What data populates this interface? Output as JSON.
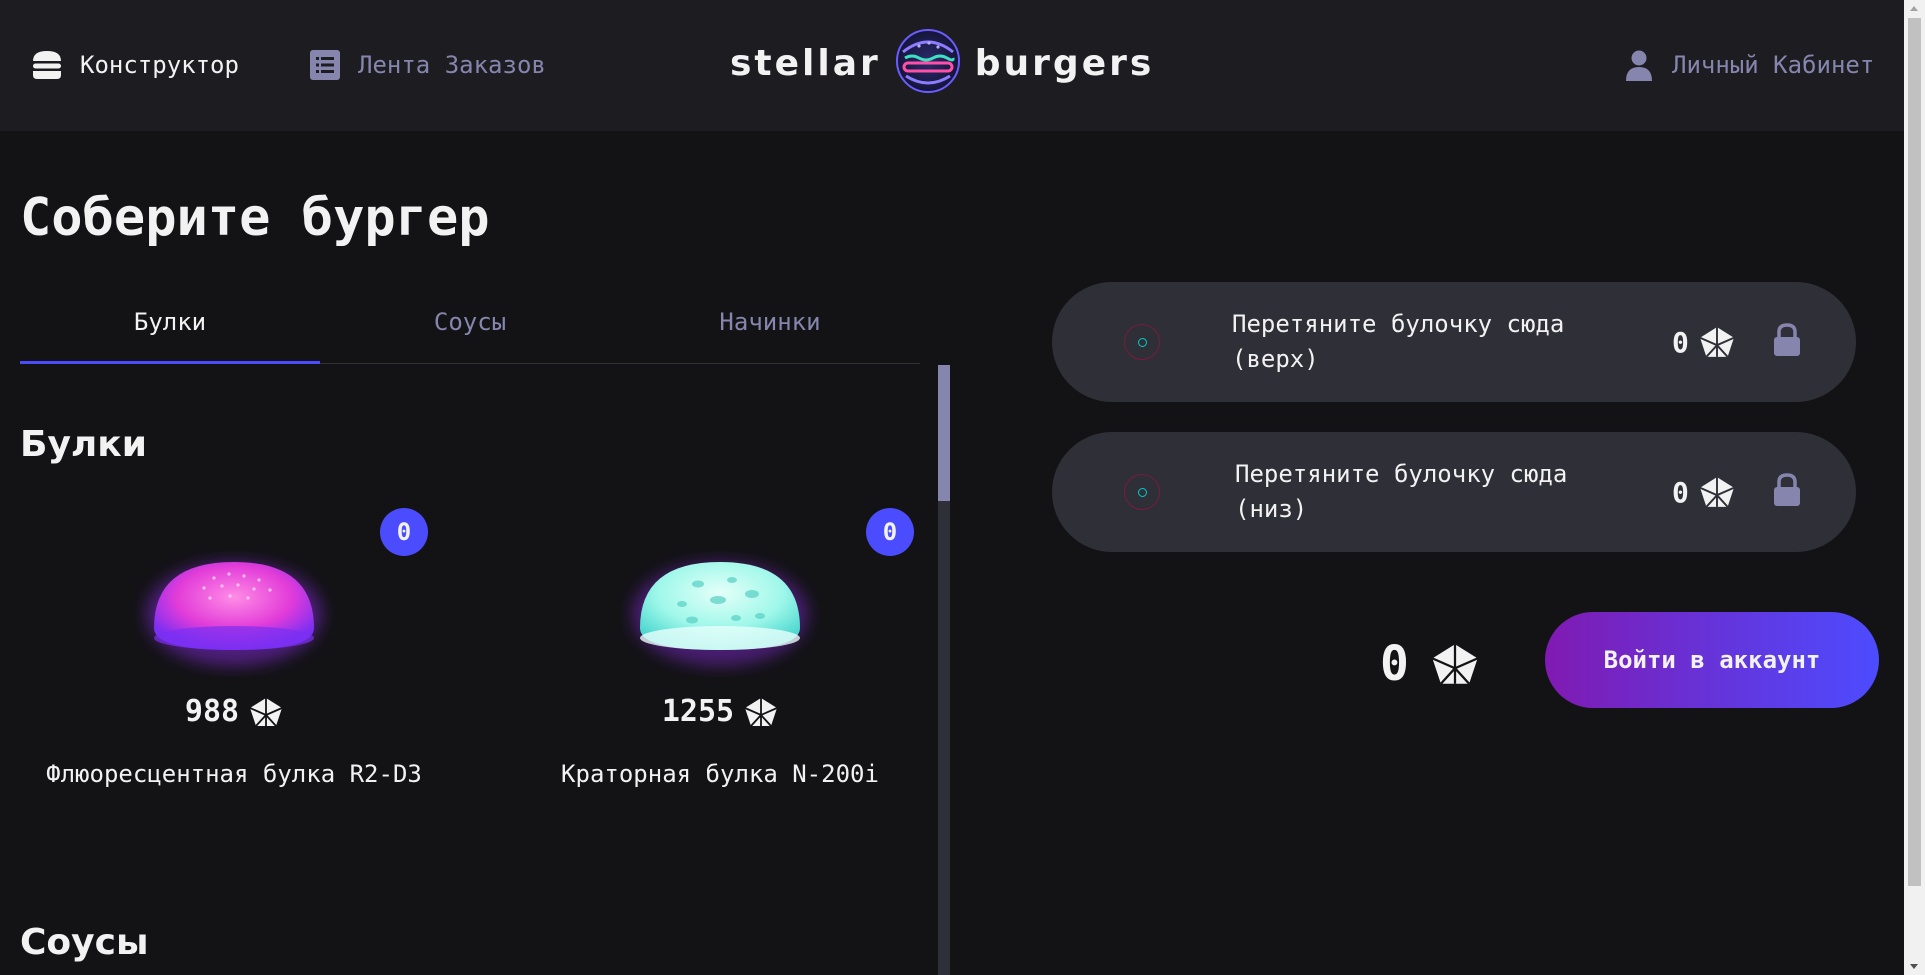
{
  "header": {
    "constructor_label": "Конструктор",
    "feed_label": "Лента Заказов",
    "logo_left": "stellar",
    "logo_right": "burgers",
    "account_label": "Личный Кабинет"
  },
  "main": {
    "title": "Соберите бургер",
    "tabs": [
      {
        "label": "Булки",
        "active": true
      },
      {
        "label": "Соусы",
        "active": false
      },
      {
        "label": "Начинки",
        "active": false
      }
    ],
    "sections": [
      {
        "title": "Булки"
      },
      {
        "title": "Соусы"
      }
    ],
    "ingredients": [
      {
        "name": "Флюоресцентная булка R2-D3",
        "price": "988",
        "count": "0",
        "color": "#e23cd8"
      },
      {
        "name": "Краторная булка N-200i",
        "price": "1255",
        "count": "0",
        "color": "#7ff5e6"
      }
    ]
  },
  "constructor": {
    "top_slot": {
      "text": "Перетяните булочку сюда (верх)",
      "price": "0"
    },
    "bottom_slot": {
      "text": "Перетяните булочку сюда (низ)",
      "price": "0"
    },
    "total": "0",
    "login_button": "Войти в аккаунт"
  },
  "colors": {
    "accent": "#4c4cff",
    "inactive": "#8585ad",
    "background": "#131316",
    "header": "#1c1c21"
  }
}
